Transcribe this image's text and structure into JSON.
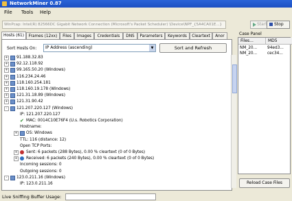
{
  "window": {
    "title": "NetworkMiner 0.87"
  },
  "menu": [
    "File",
    "Tools",
    "Help"
  ],
  "capture": {
    "path_text": "WinPcap: Intel(R) 82566DC Gigabit Network Connection (Microsoft's Packet Scheduler) \\Device\\NPF_{5A4CA01E...}",
    "start_label": "Start",
    "stop_label": "Stop"
  },
  "tabs": [
    "Hosts (61)",
    "Frames (12xx)",
    "Files",
    "Images",
    "Credentials",
    "DNS",
    "Parameters",
    "Keywords",
    "Cleartext",
    "Anor"
  ],
  "sort": {
    "label": "Sort Hosts On:",
    "value": "IP Address (ascending)",
    "button": "Sort and Refresh"
  },
  "tree": [
    {
      "text": "91.188.32.83",
      "level": 0,
      "exp": "+",
      "icon": "pc"
    },
    {
      "text": "92.12.118.92",
      "level": 0,
      "exp": "+",
      "icon": "pc"
    },
    {
      "text": "99.165.50.20 (Windows)",
      "level": 0,
      "exp": "+",
      "icon": "pc"
    },
    {
      "text": "116.234.24.46",
      "level": 0,
      "exp": "+",
      "icon": "pc"
    },
    {
      "text": "118.160.254.181",
      "level": 0,
      "exp": "+",
      "icon": "pc"
    },
    {
      "text": "118.160.19.178 (Windows)",
      "level": 0,
      "exp": "+",
      "icon": "pc"
    },
    {
      "text": "121.31.18.89 (Windows)",
      "level": 0,
      "exp": "+",
      "icon": "pc"
    },
    {
      "text": "121.31.90.42",
      "level": 0,
      "exp": "+",
      "icon": "pc"
    },
    {
      "text": "121.207.220.127 (Windows)",
      "level": 0,
      "exp": "-",
      "icon": "pc"
    },
    {
      "text": "IP: 121.207.220.127",
      "level": 1,
      "exp": "",
      "icon": ""
    },
    {
      "text": "MAC: 0014C10E76F4 (U.s. Robotics Corporation)",
      "level": 1,
      "exp": "",
      "icon": "check"
    },
    {
      "text": "Hostname:",
      "level": 1,
      "exp": "",
      "icon": ""
    },
    {
      "text": "OS: Windows",
      "level": 1,
      "exp": "+",
      "icon": "pc"
    },
    {
      "text": "TTL: 116 (distance: 12)",
      "level": 1,
      "exp": "",
      "icon": ""
    },
    {
      "text": "Open TCP Ports:",
      "level": 1,
      "exp": "",
      "icon": ""
    },
    {
      "text": "Sent: 6 packets (288 Bytes), 0.00 % cleartext (0 of 0 Bytes)",
      "level": 1,
      "exp": "+",
      "icon": "send"
    },
    {
      "text": "Received: 6 packets (240 Bytes), 0.00 % cleartext (0 of 0 Bytes)",
      "level": 1,
      "exp": "+",
      "icon": "recv"
    },
    {
      "text": "Incoming sessions: 0",
      "level": 1,
      "exp": "",
      "icon": ""
    },
    {
      "text": "Outgoing sessions: 0",
      "level": 1,
      "exp": "",
      "icon": ""
    },
    {
      "text": "123.0.211.16 (Windows)",
      "level": 0,
      "exp": "-",
      "icon": "pc"
    },
    {
      "text": "IP: 123.0.211.16",
      "level": 1,
      "exp": "",
      "icon": ""
    }
  ],
  "case_panel": {
    "title": "Case Panel",
    "col_files": "Files...",
    "col_md5": "MD5",
    "rows": [
      {
        "file": "NM_20...",
        "md5": "94ed3..."
      },
      {
        "file": "NM_20...",
        "md5": "cec34..."
      }
    ],
    "reload_label": "Reload Case Files"
  },
  "status": {
    "label": "Live Sniffing Buffer Usage:"
  }
}
